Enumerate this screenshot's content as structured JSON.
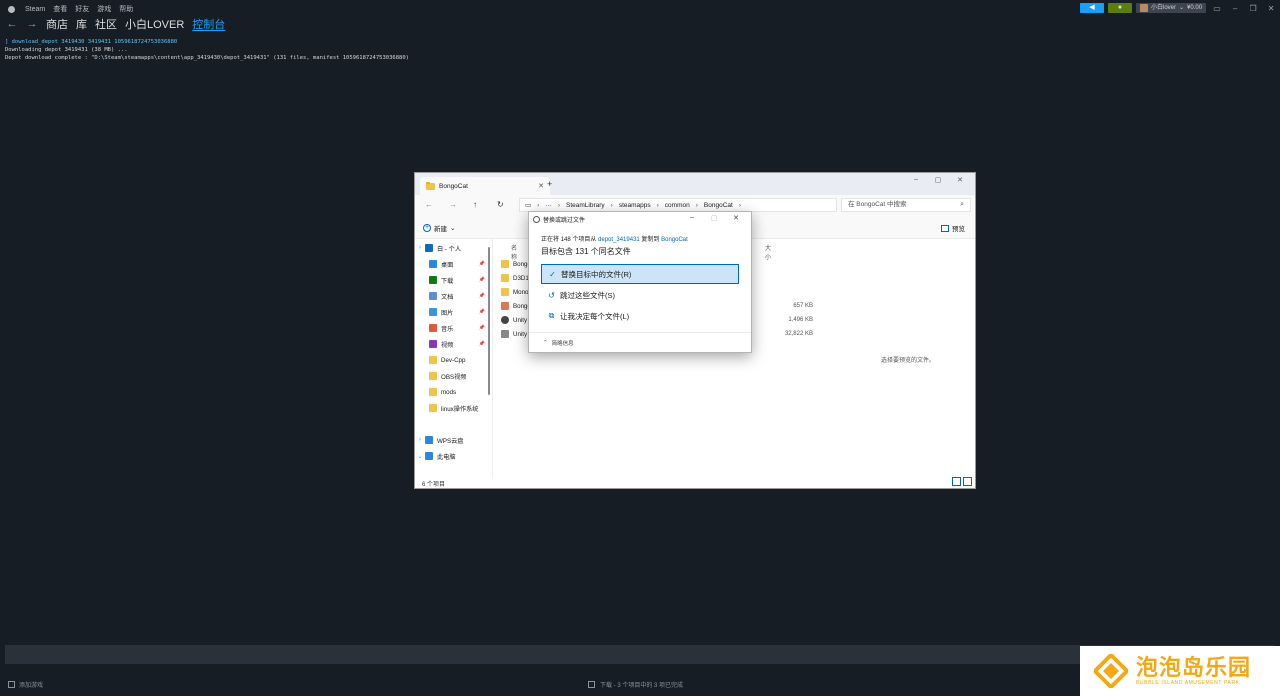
{
  "steam": {
    "menu": [
      "Steam",
      "查看",
      "好友",
      "游戏",
      "帮助"
    ],
    "nav": [
      "商店",
      "库",
      "社区",
      "小白LOVER",
      "控制台"
    ],
    "active_nav": "控制台",
    "user": {
      "name": "小白lover",
      "balance": "¥0.00"
    }
  },
  "console": {
    "lines": [
      "] download_depot 3419430 3419431 1059618724753036880",
      "Downloading depot 3419431 (38 MB) ...",
      "Depot download complete : \"D:\\Steam\\steamapps\\content\\app_3419430\\depot_3419431\" (131 files, manifest 1059618724753036880)"
    ]
  },
  "bottom": {
    "add_game": "添加游戏",
    "download_status": "下载 - 3 个项目中的 3 项已完成"
  },
  "watermark": {
    "title": "泡泡岛乐园",
    "subtitle": "BUBBLE ISLAND AMUSEMENT PARK"
  },
  "explorer": {
    "tab_title": "BongoCat",
    "breadcrumb": [
      "SteamLibrary",
      "steamapps",
      "common",
      "BongoCat"
    ],
    "search_placeholder": "在 BongoCat 中搜索",
    "new_label": "新建",
    "preview_label": "预览",
    "col_name": "名称",
    "col_size": "大小",
    "sidebar": [
      {
        "label": "白 - 个人",
        "icon": "cloud-icon",
        "color": "#0f6cbd",
        "chev": "›"
      },
      {
        "label": "桌面",
        "icon": "desktop-icon",
        "color": "#2b88d8",
        "pin": true
      },
      {
        "label": "下载",
        "icon": "download-icon",
        "color": "#107c10",
        "pin": true
      },
      {
        "label": "文档",
        "icon": "document-icon",
        "color": "#5b8fcf",
        "pin": true
      },
      {
        "label": "图片",
        "icon": "pictures-icon",
        "color": "#3a96dd",
        "pin": true
      },
      {
        "label": "音乐",
        "icon": "music-icon",
        "color": "#e05a3c",
        "pin": true
      },
      {
        "label": "视频",
        "icon": "video-icon",
        "color": "#8a3ab9",
        "pin": true
      },
      {
        "label": "Dev-Cpp",
        "icon": "folder-icon",
        "color": "#f0c34d"
      },
      {
        "label": "OBS视频",
        "icon": "folder-icon",
        "color": "#f0c34d"
      },
      {
        "label": "mods",
        "icon": "folder-icon",
        "color": "#f0c34d"
      },
      {
        "label": "linux操作系统",
        "icon": "folder-icon",
        "color": "#f0c34d"
      },
      {
        "label": "WPS云盘",
        "icon": "cloud-icon",
        "color": "#2b88d8",
        "chev": "›"
      },
      {
        "label": "此电脑",
        "icon": "pc-icon",
        "color": "#2b88d8",
        "chev": "⌄"
      }
    ],
    "files": [
      {
        "name": "Bongo",
        "icon": "folder-icon",
        "color": "#f0c34d",
        "size": ""
      },
      {
        "name": "D3D1",
        "icon": "folder-icon",
        "color": "#f0c34d",
        "size": ""
      },
      {
        "name": "Mono",
        "icon": "folder-icon",
        "color": "#f0c34d",
        "size": ""
      },
      {
        "name": "Bongo",
        "icon": "app-icon",
        "color": "#d77a56",
        "size": "657 KB"
      },
      {
        "name": "Unity",
        "icon": "unity-icon",
        "color": "#444444",
        "size": "1,496 KB"
      },
      {
        "name": "Unity",
        "icon": "file-icon",
        "color": "#888888",
        "size": "32,822 KB"
      }
    ],
    "preview_msg": "选择要预览的文件。",
    "status": "6 个项目"
  },
  "dialog": {
    "title": "替换或跳过文件",
    "line_prefix": "正在将 148 个项目从",
    "source": "depot_3419431",
    "line_mid": "复制到",
    "dest": "BongoCat",
    "heading": "目标包含 131 个同名文件",
    "options": [
      {
        "label": "替换目标中的文件(R)",
        "icon": "check-icon",
        "glyph": "✓",
        "selected": true
      },
      {
        "label": "跳过这些文件(S)",
        "icon": "skip-icon",
        "glyph": "↺",
        "selected": false
      },
      {
        "label": "让我决定每个文件(L)",
        "icon": "decide-icon",
        "glyph": "⧉",
        "selected": false
      }
    ],
    "details": "简略信息"
  }
}
